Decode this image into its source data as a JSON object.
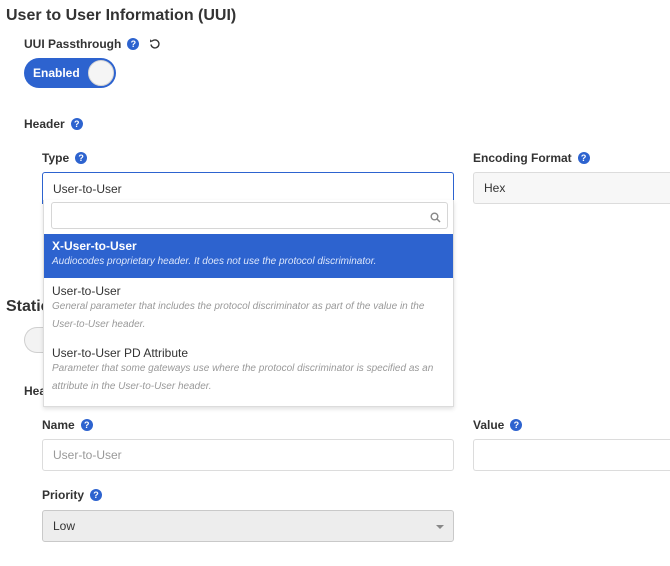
{
  "section": {
    "title": "User to User Information (UUI)",
    "title_partial_static": "Static",
    "partial_hea": "Hea"
  },
  "uui_passthrough": {
    "label": "UUI Passthrough",
    "toggle_text": "Enabled"
  },
  "header": {
    "label": "Header"
  },
  "type_field": {
    "label": "Type",
    "value": "User-to-User"
  },
  "encoding_field": {
    "label": "Encoding Format",
    "value": "Hex"
  },
  "dropdown": {
    "search_value": "",
    "options": [
      {
        "title": "X-User-to-User",
        "description": "Audiocodes proprietary header. It does not use the protocol discriminator.",
        "selected": true
      },
      {
        "title": "User-to-User",
        "description": "General parameter that includes the protocol discriminator as part of the value in the User-to-User header.",
        "selected": false
      },
      {
        "title": "User-to-User PD Attribute",
        "description": "Parameter that some gateways use where the protocol discriminator is specified as an attribute in the User-to-User header.",
        "selected": false
      }
    ]
  },
  "name_field": {
    "label": "Name",
    "placeholder": "User-to-User"
  },
  "value_field": {
    "label": "Value",
    "value": ""
  },
  "priority_field": {
    "label": "Priority",
    "value": "Low"
  },
  "colors": {
    "accent": "#2d63cf",
    "help_icon": "#2d63cf",
    "text": "#333333",
    "muted": "#999999"
  }
}
